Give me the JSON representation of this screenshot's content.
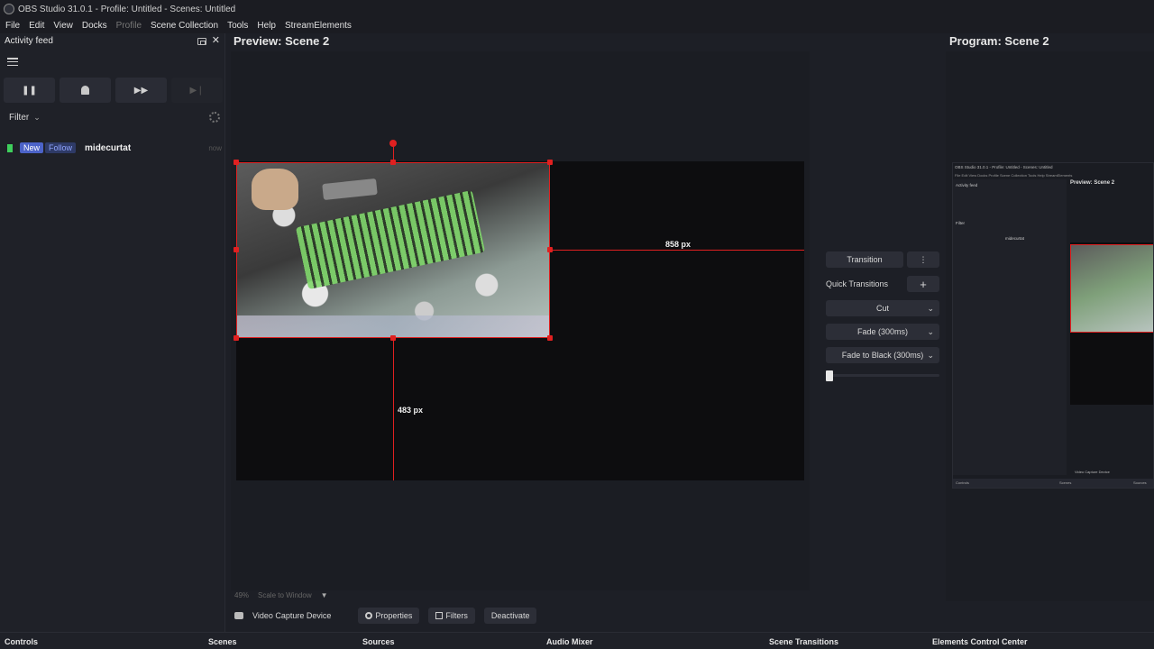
{
  "window": {
    "title": "OBS Studio 31.0.1 - Profile: Untitled - Scenes: Untitled"
  },
  "menu": [
    "File",
    "Edit",
    "View",
    "Docks",
    "Profile",
    "Scene Collection",
    "Tools",
    "Help",
    "StreamElements"
  ],
  "activity_feed": {
    "title": "Activity feed",
    "filter_label": "Filter",
    "items": [
      {
        "badge_new": "New",
        "badge_type": "Follow",
        "user": "midecurtat",
        "time": "now"
      }
    ]
  },
  "preview": {
    "label": "Preview: Scene 2",
    "dist_horizontal": "858 px",
    "dist_vertical": "483 px"
  },
  "zoom": {
    "percent": "49%",
    "mode": "Scale to Window"
  },
  "transitions": {
    "transition_label": "Transition",
    "quick_label": "Quick Transitions",
    "options": [
      "Cut",
      "Fade (300ms)",
      "Fade to Black (300ms)"
    ]
  },
  "program": {
    "label": "Program: Scene 2"
  },
  "source_toolbar": {
    "source_name": "Video Capture Device",
    "properties": "Properties",
    "filters": "Filters",
    "deactivate": "Deactivate"
  },
  "bottom_docks": [
    "Controls",
    "Scenes",
    "Sources",
    "Audio Mixer",
    "Scene Transitions",
    "Elements Control Center"
  ],
  "mini_program": {
    "title": "OBS Studio 31.0.1 - Profile: Untitled - Scenes: Untitled",
    "menu": "File  Edit  View  Docks  Profile  Scene Collection  Tools  Help  StreamElements",
    "dock_title": "Activity feed",
    "filter": "Filter",
    "feed_user": "midecurtat",
    "preview": "Preview: Scene 2",
    "source": "Video Capture Device",
    "docks": [
      "Controls",
      "Scenes",
      "Sources"
    ]
  }
}
